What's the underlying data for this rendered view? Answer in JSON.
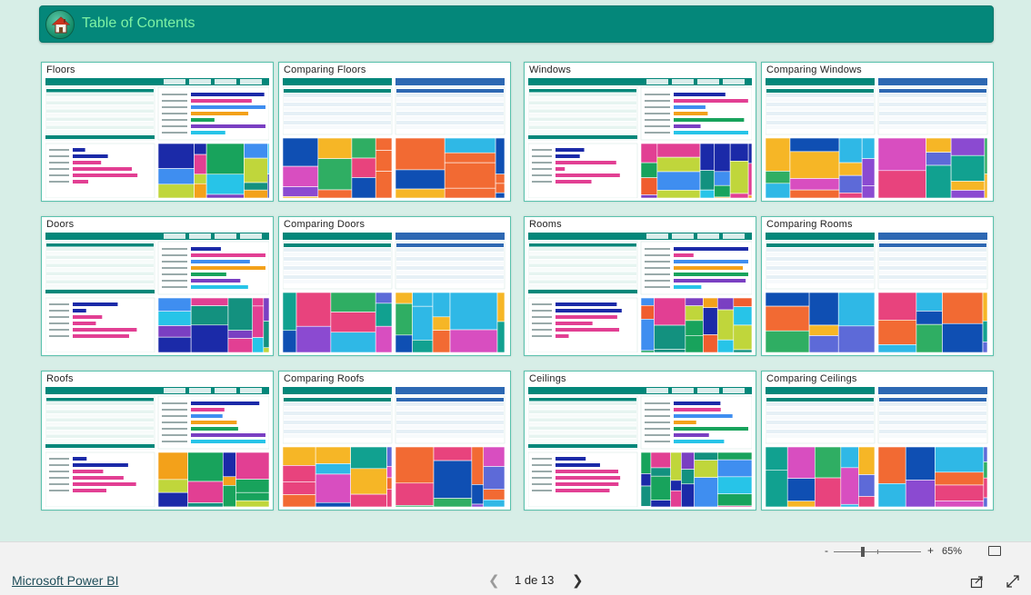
{
  "header": {
    "title": "Table of Contents",
    "icon": "house-icon",
    "background": "#04877a",
    "title_color": "#7ef2a4"
  },
  "pages": [
    {
      "label": "Floors"
    },
    {
      "label": "Comparing Floors"
    },
    {
      "label": "Windows"
    },
    {
      "label": "Comparing Windows"
    },
    {
      "label": "Doors"
    },
    {
      "label": "Comparing Doors"
    },
    {
      "label": "Rooms"
    },
    {
      "label": "Comparing Rooms"
    },
    {
      "label": "Roofs"
    },
    {
      "label": "Comparing Roofs"
    },
    {
      "label": "Ceilings"
    },
    {
      "label": "Comparing Ceilings"
    }
  ],
  "zoom": {
    "minus": "-",
    "plus": "+",
    "value": "65%",
    "level": 0.65
  },
  "footer": {
    "brand_link": "Microsoft Power BI",
    "page_indicator": "1 de 13",
    "prev_icon": "chevron-left-icon",
    "next_icon": "chevron-right-icon",
    "share_icon": "share-icon",
    "fullscreen_icon": "fullscreen-icon"
  },
  "colors": {
    "canvas": "#d7eee7",
    "accent": "#04877a",
    "tile_border": "#59c2ad"
  }
}
